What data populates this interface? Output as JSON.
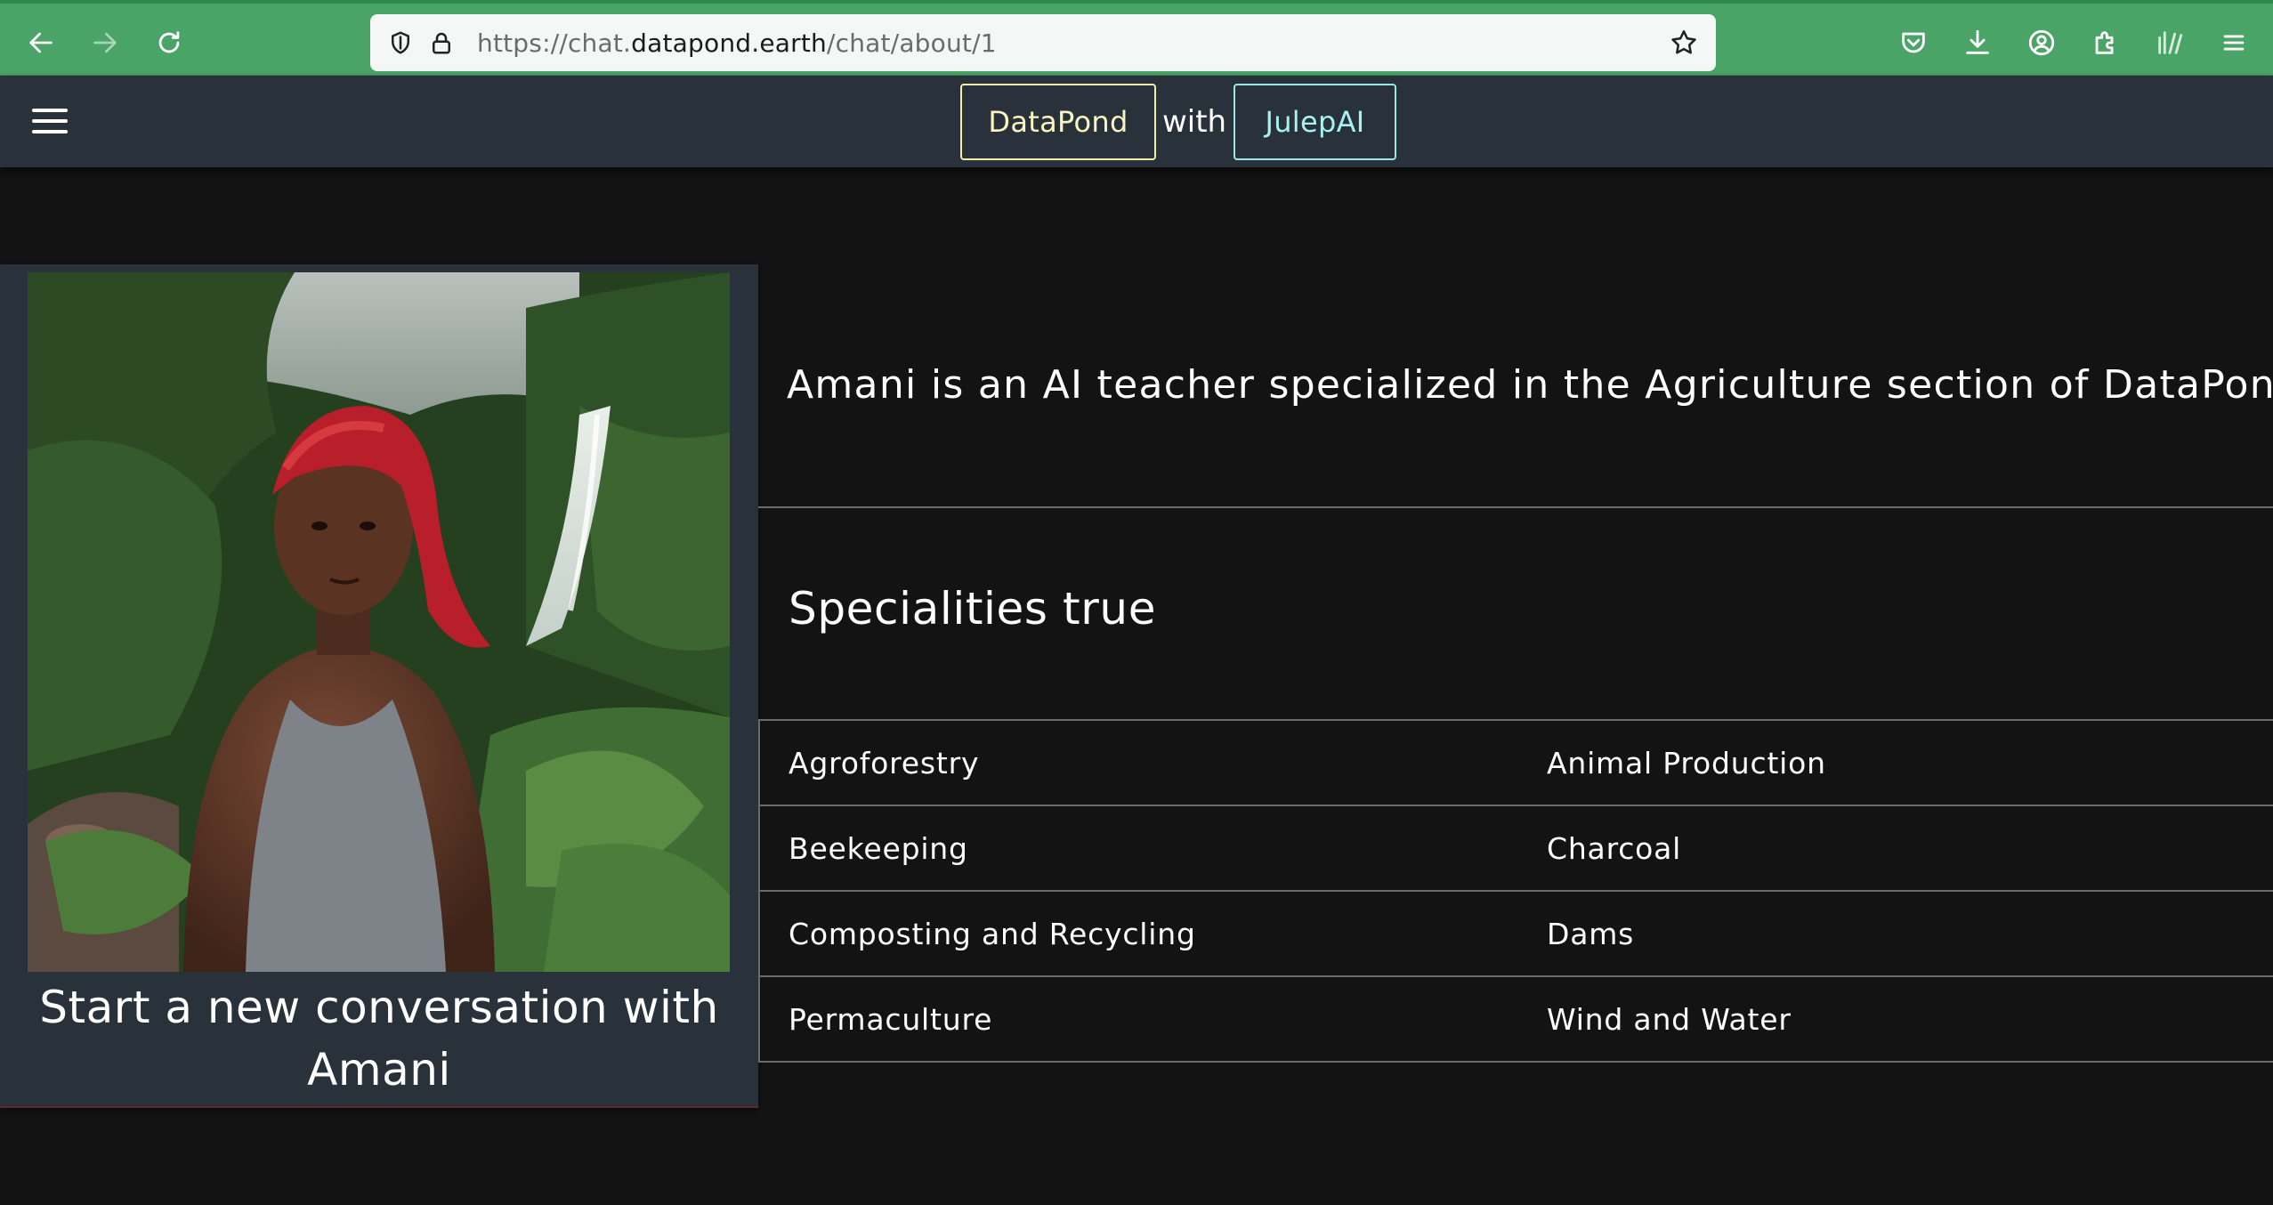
{
  "browser": {
    "url_prefix": "https://chat.",
    "url_host": "datapond.earth",
    "url_path": "/chat/about/1",
    "icons": {
      "back": "back-arrow-icon",
      "forward": "forward-arrow-icon",
      "reload": "reload-icon",
      "shield": "shield-icon",
      "lock": "lock-icon",
      "bookmark": "star-icon",
      "pocket": "pocket-icon",
      "downloads": "download-icon",
      "account": "account-icon",
      "extensions": "puzzle-icon",
      "library": "library-icon",
      "menu": "menu-icon"
    },
    "colors": {
      "toolbar": "#4aa367",
      "url_bg": "#f4f7f5"
    }
  },
  "header": {
    "brand_left": "DataPond",
    "connector": "with",
    "brand_right": "JulepAI",
    "colors": {
      "bg": "#29323a",
      "brand_left": "#fbf6c0",
      "brand_right": "#a9f0f0"
    }
  },
  "profile": {
    "portrait_alt": "Amani",
    "start_line_1": "Start a new conversation with",
    "start_line_2": "Amani"
  },
  "main": {
    "description": "Amani is an AI teacher specialized in the Agriculture section of DataPond.",
    "specialities_heading": "Specialities true",
    "specialities": [
      [
        "Agroforestry",
        "Animal Production"
      ],
      [
        "Beekeeping",
        "Charcoal"
      ],
      [
        "Composting and Recycling",
        "Dams"
      ],
      [
        "Permaculture",
        "Wind and Water"
      ]
    ]
  },
  "colors": {
    "page_bg": "#131313",
    "card_bg": "#29323a",
    "divider": "#6b6b6b"
  }
}
